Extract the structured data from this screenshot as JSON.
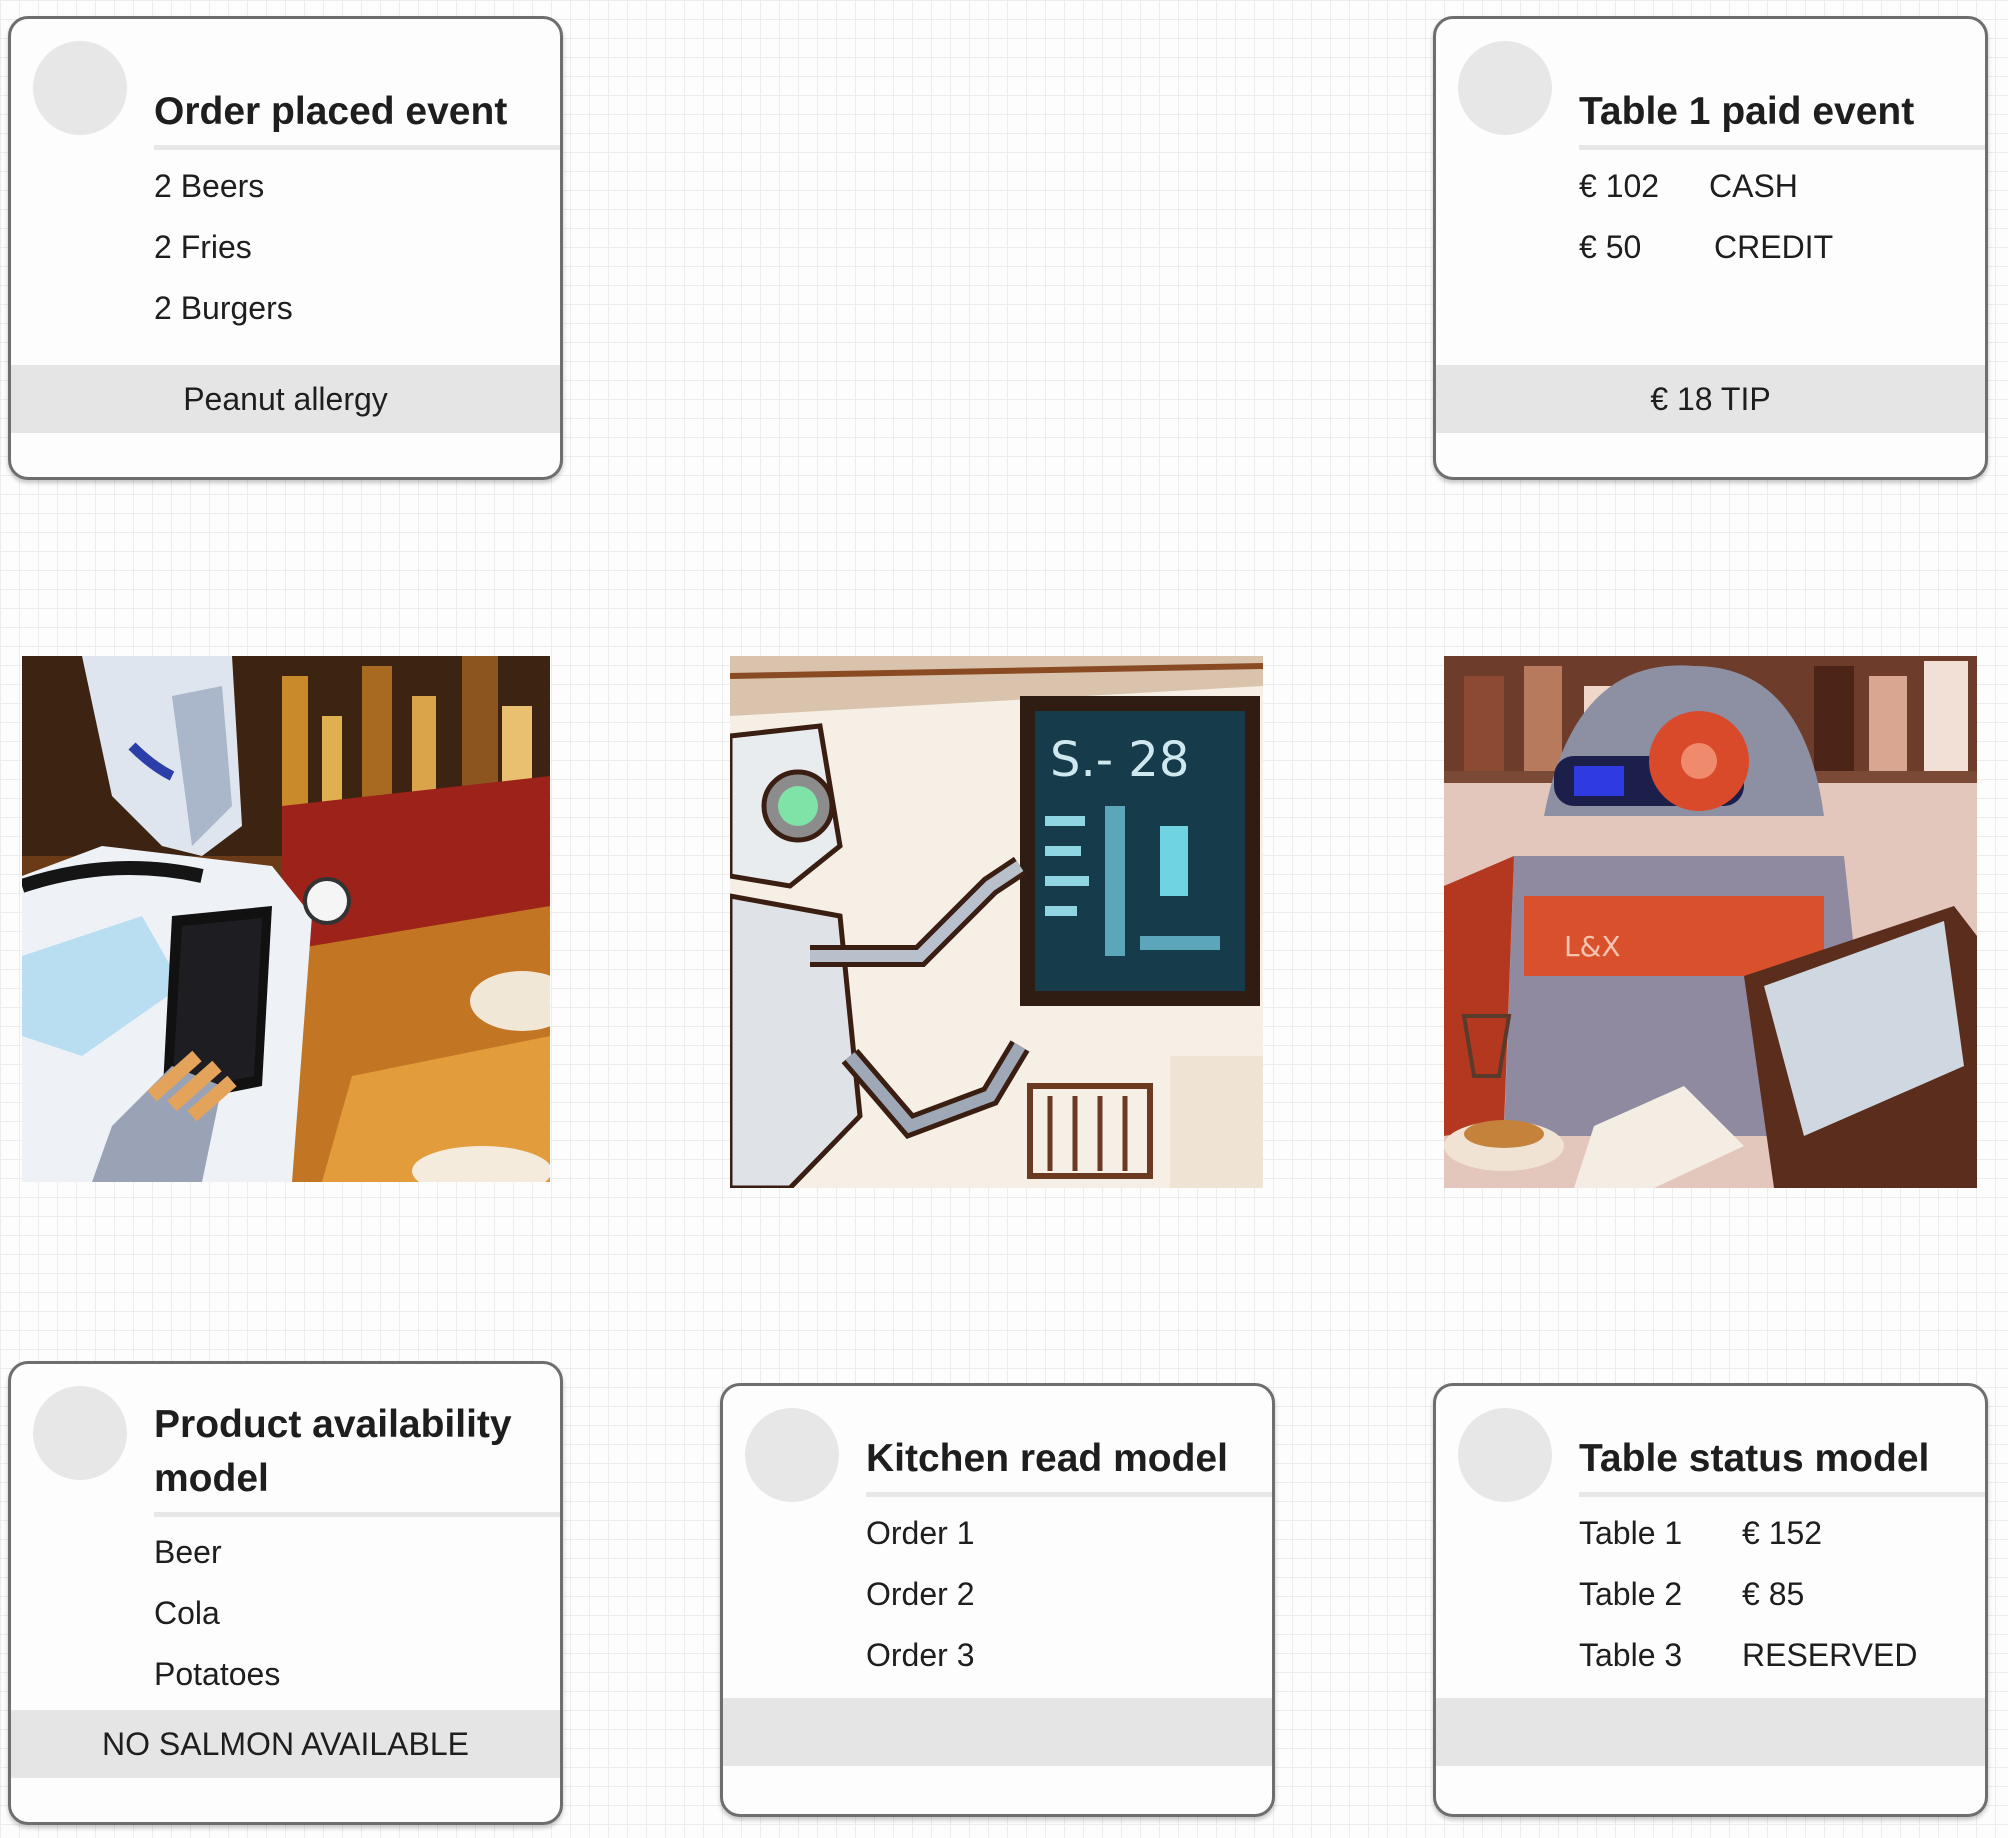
{
  "cards": {
    "order": {
      "title": "Order placed event",
      "items": [
        "2 Beers",
        "2 Fries",
        "2 Burgers"
      ],
      "footer": "Peanut allergy"
    },
    "paid": {
      "title": "Table 1 paid event",
      "rows": [
        {
          "amount": "€ 102",
          "method": "CASH"
        },
        {
          "amount": "€ 50",
          "method": "CREDIT"
        }
      ],
      "footer": "€ 18 TIP"
    },
    "availability": {
      "title": "Product availability model",
      "items": [
        "Beer",
        "Cola",
        "Potatoes"
      ],
      "footer": "NO SALMON AVAILABLE"
    },
    "kitchen": {
      "title": "Kitchen read model",
      "items": [
        "Order 1",
        "Order 2",
        "Order 3"
      ],
      "footer": ""
    },
    "table_status": {
      "title": "Table status model",
      "rows": [
        {
          "table": "Table 1",
          "value": "€ 152"
        },
        {
          "table": "Table 2",
          "value": "€ 85"
        },
        {
          "table": "Table 3",
          "value": "RESERVED"
        }
      ],
      "footer": ""
    }
  },
  "images": [
    {
      "name": "robot-holding-phone-image"
    },
    {
      "name": "robot-reading-menu-board-image"
    },
    {
      "name": "robot-at-register-image"
    }
  ]
}
